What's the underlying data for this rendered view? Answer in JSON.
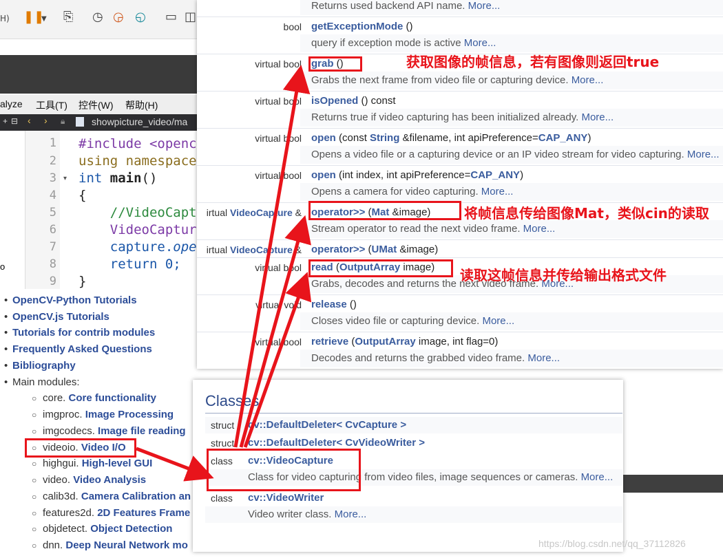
{
  "ide": {
    "menu": [
      "alyze",
      "工具(T)",
      "控件(W)",
      "帮助(H)"
    ],
    "tab_label": "showpicture_video/ma",
    "line_numbers": [
      "1",
      "2",
      "3",
      "4",
      "5",
      "6",
      "7",
      "8",
      "9"
    ],
    "code": {
      "l1": "#include <openc",
      "l2": "using namespace",
      "l3_kw": "int ",
      "l3_fn": "main",
      "l3_rest": "()",
      "l4": "{",
      "l5": "    //VideoCapt",
      "l6": "    VideoCapture",
      "l7a": "    capture.",
      "l7b": "ope",
      "l8": "    return 0;",
      "l9": "}"
    },
    "left_edge_h": "H)",
    "left_edge_o": "o"
  },
  "left_list": {
    "top_items": [
      "OpenCV-Python Tutorials",
      "OpenCV.js Tutorials",
      "Tutorials for contrib modules",
      "Frequently Asked Questions",
      "Bibliography"
    ],
    "main_modules_label": "Main modules:",
    "modules": [
      {
        "prefix": "core. ",
        "link": "Core functionality"
      },
      {
        "prefix": "imgproc. ",
        "link": "Image Processing"
      },
      {
        "prefix": "imgcodecs. ",
        "link": "Image file reading"
      },
      {
        "prefix": "videoio. ",
        "link": "Video I/O"
      },
      {
        "prefix": "highgui. ",
        "link": "High-level GUI"
      },
      {
        "prefix": "video. ",
        "link": "Video Analysis"
      },
      {
        "prefix": "calib3d. ",
        "link": "Camera Calibration an"
      },
      {
        "prefix": "features2d. ",
        "link": "2D Features Frame"
      },
      {
        "prefix": "objdetect. ",
        "link": "Object Detection"
      },
      {
        "prefix": "dnn. ",
        "link": "Deep Neural Network mo"
      }
    ]
  },
  "doc": {
    "rows": [
      {
        "type": "",
        "name": "",
        "args": "",
        "desc": "Returns used backend API name. ",
        "more": "More..."
      },
      {
        "type": "bool",
        "name": "getExceptionMode",
        "args": " ()",
        "desc": "query if exception mode is active ",
        "more": "More..."
      },
      {
        "type": "virtual bool",
        "name": "grab",
        "args": " ()",
        "desc": "Grabs the next frame from video file or capturing device. ",
        "more": "More..."
      },
      {
        "type": "virtual bool",
        "name": "isOpened",
        "args": " () const",
        "desc": "Returns true if video capturing has been initialized already. ",
        "more": "More..."
      },
      {
        "type": "virtual bool",
        "name": "open",
        "args_html_parts": [
          " (const ",
          "String",
          " &filename, int apiPreference=",
          "CAP_ANY",
          ")"
        ],
        "desc": "Opens a video file or a capturing device or an IP video stream for video capturing. ",
        "more": "More..."
      },
      {
        "type": "virtual bool",
        "name": "open",
        "args_html_parts": [
          " (int index, int apiPreference=",
          "CAP_ANY",
          ")"
        ],
        "desc": "Opens a camera for video capturing. ",
        "more": "More..."
      },
      {
        "type_parts": [
          "irtual ",
          "VideoCapture",
          " &"
        ],
        "name": "operator>>",
        "args_html_parts": [
          " (",
          "Mat",
          " &image)"
        ],
        "desc": "Stream operator to read the next video frame. ",
        "more": "More..."
      },
      {
        "type_parts": [
          "irtual ",
          "VideoCapture",
          " &"
        ],
        "name": "operator>>",
        "args_html_parts": [
          " (",
          "UMat",
          " &image)"
        ],
        "desc": "",
        "more": ""
      },
      {
        "type": "virtual bool",
        "name": "read",
        "args_html_parts": [
          " (",
          "OutputArray",
          " image)"
        ],
        "desc": "Grabs, decodes and returns the next video frame. ",
        "more": "More..."
      },
      {
        "type": "virtual void",
        "name": "release",
        "args": " ()",
        "desc": "Closes video file or capturing device. ",
        "more": "More..."
      },
      {
        "type": "virtual bool",
        "name": "retrieve",
        "args_html_parts": [
          " (",
          "OutputArray",
          " image, int flag=0)"
        ],
        "desc": "Decodes and returns the grabbed video frame. ",
        "more": "More..."
      }
    ]
  },
  "classes": {
    "title": "Classes",
    "rows": [
      {
        "kind": "struct",
        "name": "cv::DefaultDeleter< CvCapture >",
        "desc": ""
      },
      {
        "kind": "struct",
        "name": "cv::DefaultDeleter< CvVideoWriter >",
        "desc": ""
      },
      {
        "kind": "class",
        "name": "cv::VideoCapture",
        "desc": "Class for video capturing from video files, image sequences or cameras. ",
        "more": "More..."
      },
      {
        "kind": "class",
        "name": "cv::VideoWriter",
        "desc": "Video writer class. ",
        "more": "More..."
      }
    ]
  },
  "annotations": {
    "grab_note": "获取图像的帧信息，若有图像则返回true",
    "operator_note": "将帧信息传给图像Mat，类似cin的读取",
    "read_note": "读取这帧信息并传给输出格式文件"
  },
  "colors": {
    "annotation": "#e8141b",
    "link": "#3a5c9e"
  },
  "watermark": "https://blog.csdn.net/qq_37112826"
}
